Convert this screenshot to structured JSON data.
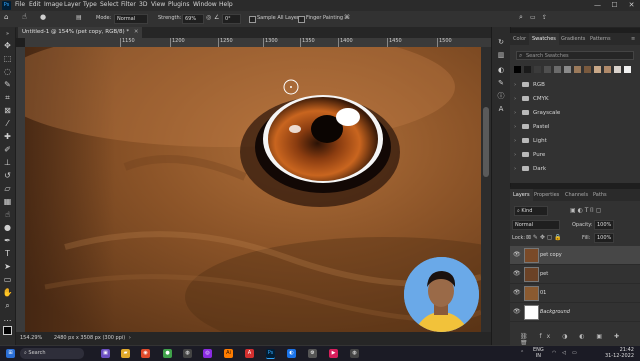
{
  "menubar": {
    "items": [
      "File",
      "Edit",
      "Image",
      "Layer",
      "Type",
      "Select",
      "Filter",
      "3D",
      "View",
      "Plugins",
      "Window",
      "Help"
    ]
  },
  "options": {
    "mode_label": "Mode:",
    "mode_value": "Normal",
    "strength_label": "Strength:",
    "strength_value": "69%",
    "angle_value": "0°",
    "sample_all_layers": "Sample All Layers",
    "finger_painting": "Finger Painting"
  },
  "document": {
    "tab_title": "Untitled-1 @ 154% (pet copy, RGB/8) *",
    "zoom": "154.29%",
    "size_info": "2480 px x 3508 px (300 ppi)"
  },
  "ruler": {
    "ticks": [
      "1150",
      "1200",
      "1250",
      "1300",
      "1350",
      "1400",
      "1450",
      "1500"
    ]
  },
  "swatches_panel": {
    "tabs": [
      "Color",
      "Swatches",
      "Gradients",
      "Patterns"
    ],
    "search_placeholder": "Search Swatches",
    "recent_colors": [
      "#000000",
      "#1a1a1a",
      "#3b3b3b",
      "#4f4f4f",
      "#6b6b6b",
      "#8a8a8a",
      "#9b7a5b",
      "#7a5a3e",
      "#c9a888",
      "#b08a6a",
      "#d9d2cc",
      "#f2f2f2"
    ],
    "folders": [
      "RGB",
      "CMYK",
      "Grayscale",
      "Pastel",
      "Light",
      "Pure",
      "Dark"
    ]
  },
  "layers_panel": {
    "tabs": [
      "Layers",
      "Properties",
      "Channels",
      "Paths"
    ],
    "kind_label": "Kind",
    "blend_mode": "Normal",
    "opacity_label": "Opacity:",
    "opacity_value": "100%",
    "lock_label": "Lock:",
    "fill_label": "Fill:",
    "fill_value": "100%",
    "layers": [
      {
        "name": "pet copy",
        "selected": true,
        "thumb": "#7a4a28"
      },
      {
        "name": "pet",
        "selected": false,
        "thumb": "#6b4226"
      },
      {
        "name": "01",
        "selected": false,
        "thumb": "#8a5a30"
      },
      {
        "name": "Background",
        "selected": false,
        "thumb": "#ffffff"
      }
    ]
  },
  "taskbar": {
    "search_label": "Search",
    "lang": "ENG",
    "region": "IN",
    "time": "21:42",
    "date": "31-12-2022"
  },
  "colors": {
    "accent": "#31a8ff",
    "panel_bg": "#323232",
    "selected_layer": "#474747"
  }
}
